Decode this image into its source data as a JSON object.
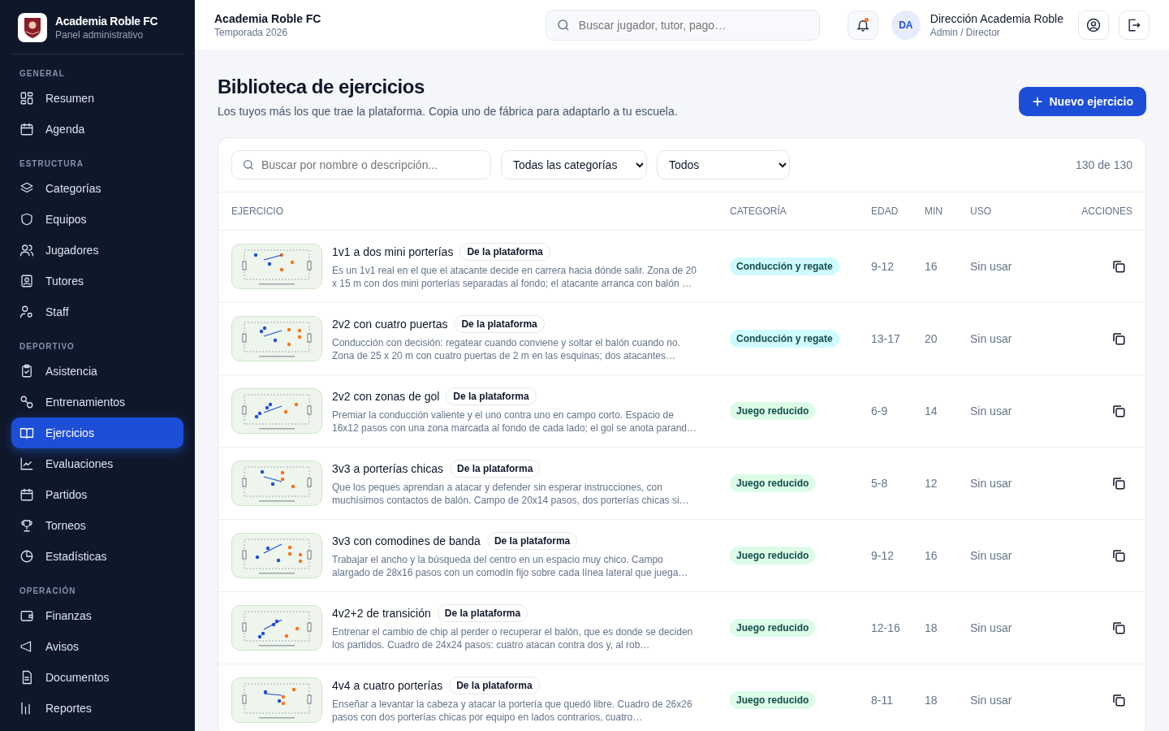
{
  "brand": {
    "name": "Academia Roble FC",
    "subtitle": "Panel administrativo"
  },
  "sidebar": {
    "sections": [
      {
        "title": "GENERAL",
        "items": [
          {
            "label": "Resumen",
            "selected": false
          },
          {
            "label": "Agenda",
            "selected": false
          }
        ]
      },
      {
        "title": "ESTRUCTURA",
        "items": [
          {
            "label": "Categorías",
            "selected": false
          },
          {
            "label": "Equipos",
            "selected": false
          },
          {
            "label": "Jugadores",
            "selected": false
          },
          {
            "label": "Tutores",
            "selected": false
          },
          {
            "label": "Staff",
            "selected": false
          }
        ]
      },
      {
        "title": "DEPORTIVO",
        "items": [
          {
            "label": "Asistencia",
            "selected": false
          },
          {
            "label": "Entrenamientos",
            "selected": false
          },
          {
            "label": "Ejercicios",
            "selected": true
          },
          {
            "label": "Evaluaciones",
            "selected": false
          },
          {
            "label": "Partidos",
            "selected": false
          },
          {
            "label": "Torneos",
            "selected": false
          },
          {
            "label": "Estadísticas",
            "selected": false
          }
        ]
      },
      {
        "title": "OPERACIÓN",
        "items": [
          {
            "label": "Finanzas",
            "selected": false
          },
          {
            "label": "Avisos",
            "selected": false
          },
          {
            "label": "Documentos",
            "selected": false
          },
          {
            "label": "Reportes",
            "selected": false
          }
        ]
      }
    ]
  },
  "topbar": {
    "club": "Academia Roble FC",
    "season": "Temporada 2026",
    "search": {
      "placeholder": "Buscar jugador, tutor, pago…"
    },
    "notifications": {
      "unread": true
    },
    "user": {
      "initials": "DA",
      "name": "Dirección Academia Roble",
      "role": "Admin / Director"
    }
  },
  "page": {
    "title": "Biblioteca de ejercicios",
    "subtitle": "Los tuyos más los que trae la plataforma. Copia uno de fábrica para adaptarlo a tu escuela.",
    "new_button": "Nuevo ejercicio"
  },
  "filters": {
    "search": {
      "placeholder": "Buscar por nombre o descripción..."
    },
    "category": "Todas las categorías",
    "origin": "Todos",
    "count": "130 de 130"
  },
  "table": {
    "columns": [
      "EJERCICIO",
      "CATEGORÍA",
      "EDAD",
      "MIN",
      "USO",
      "ACCIONES"
    ],
    "rows": [
      {
        "kind": "picture",
        "name": "1v1 a dos mini porterías",
        "badge": "De la plataforma",
        "description": "Es un 1v1 real en el que el atacante decide en carrera hacia dónde salir. Zona de 20 x 15 m con dos mini porterías separadas al fondo; el atacante arranca con balón …",
        "category": {
          "label": "Conducción y regate",
          "color": "#cffafe"
        },
        "age": "9-12",
        "min": "16",
        "use": "Sin usar"
      },
      {
        "kind": "picture",
        "name": "2v2 con cuatro puertas",
        "badge": "De la plataforma",
        "description": "Conducción con decisión: regatear cuando conviene y soltar el balón cuando no. Zona de 25 x 20 m con cuatro puertas de 2 m en las esquinas; dos atacantes…",
        "category": {
          "label": "Conducción y regate",
          "color": "#cffafe"
        },
        "age": "13-17",
        "min": "20",
        "use": "Sin usar"
      },
      {
        "kind": "picture",
        "name": "2v2 con zonas de gol",
        "badge": "De la plataforma",
        "description": "Premiar la conducción valiente y el uno contra uno en campo corto. Espacio de 16x12 pasos con una zona marcada al fondo de cada lado; el gol se anota parand…",
        "category": {
          "label": "Juego reducido",
          "color": "#dcfce7"
        },
        "age": "6-9",
        "min": "14",
        "use": "Sin usar"
      },
      {
        "kind": "picture",
        "name": "3v3 a porterías chicas",
        "badge": "De la plataforma",
        "description": "Que los peques aprendan a atacar y defender sin esperar instrucciones, con muchísimos contactos de balón. Campo de 20x14 pasos, dos porterías chicas si…",
        "category": {
          "label": "Juego reducido",
          "color": "#dcfce7"
        },
        "age": "5-8",
        "min": "12",
        "use": "Sin usar"
      },
      {
        "kind": "picture",
        "name": "3v3 con comodines de banda",
        "badge": "De la plataforma",
        "description": "Trabajar el ancho y la búsqueda del centro en un espacio muy chico. Campo alargado de 28x16 pasos con un comodín fijo sobre cada línea lateral que juega…",
        "category": {
          "label": "Juego reducido",
          "color": "#dcfce7"
        },
        "age": "9-12",
        "min": "16",
        "use": "Sin usar"
      },
      {
        "kind": "picture",
        "name": "4v2+2 de transición",
        "badge": "De la plataforma",
        "description": "Entrenar el cambio de chip al perder o recuperar el balón, que es donde se deciden los partidos. Cuadro de 24x24 pasos: cuatro atacan contra dos y, al rob…",
        "category": {
          "label": "Juego reducido",
          "color": "#dcfce7"
        },
        "age": "12-16",
        "min": "18",
        "use": "Sin usar"
      },
      {
        "kind": "picture",
        "name": "4v4 a cuatro porterías",
        "badge": "De la plataforma",
        "description": "Enseñar a levantar la cabeza y atacar la portería que quedó libre. Cuadro de 26x26 pasos con dos porterías chicas por equipo en lados contrarios, cuatro…",
        "category": {
          "label": "Juego reducido",
          "color": "#dcfce7"
        },
        "age": "8-11",
        "min": "18",
        "use": "Sin usar"
      }
    ]
  }
}
